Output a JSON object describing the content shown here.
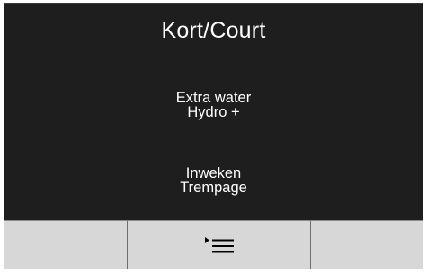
{
  "screen": {
    "title": "Kort/Court",
    "options": [
      {
        "line1": "Extra water",
        "line2": "Hydro +"
      },
      {
        "line1": "Inweken",
        "line2": "Trempage"
      }
    ]
  },
  "buttons": [
    {
      "name": "left-soft-button",
      "icon": ""
    },
    {
      "name": "menu-button",
      "icon": "menu-list-icon"
    },
    {
      "name": "right-soft-button",
      "icon": ""
    }
  ],
  "colors": {
    "screen_bg": "#1e1e1e",
    "text": "#ffffff",
    "button_bg": "#d7d7d7"
  }
}
